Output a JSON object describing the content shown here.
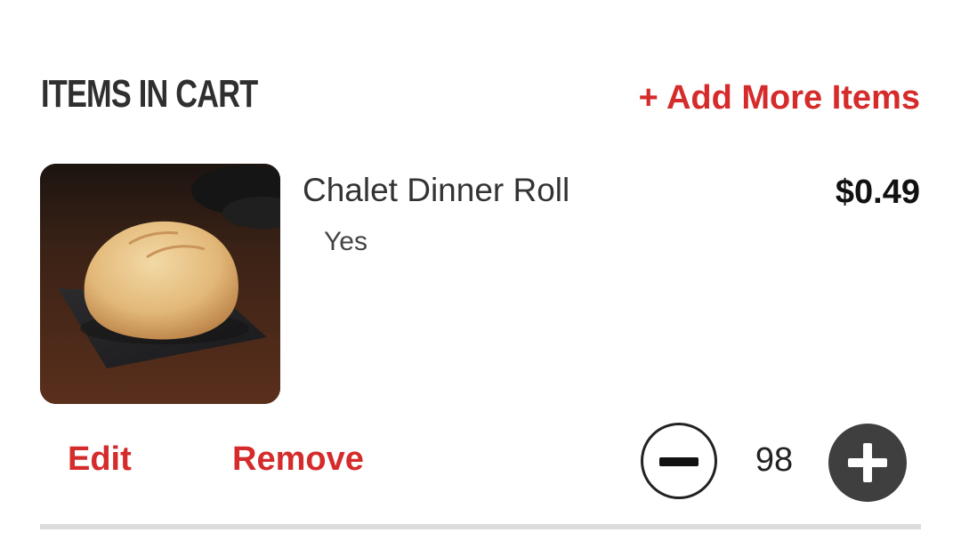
{
  "cart": {
    "title": "ITEMS IN CART",
    "add_more_label": "+ Add More Items"
  },
  "item": {
    "name": "Chalet Dinner Roll",
    "option": "Yes",
    "price": "$0.49",
    "image_icon": "dinner-roll-photo",
    "edit_label": "Edit",
    "remove_label": "Remove",
    "quantity": "98"
  },
  "colors": {
    "accent": "#d52b2b",
    "text": "#333333",
    "plus_button": "#3f3f3f",
    "divider": "#dcdcdc"
  }
}
